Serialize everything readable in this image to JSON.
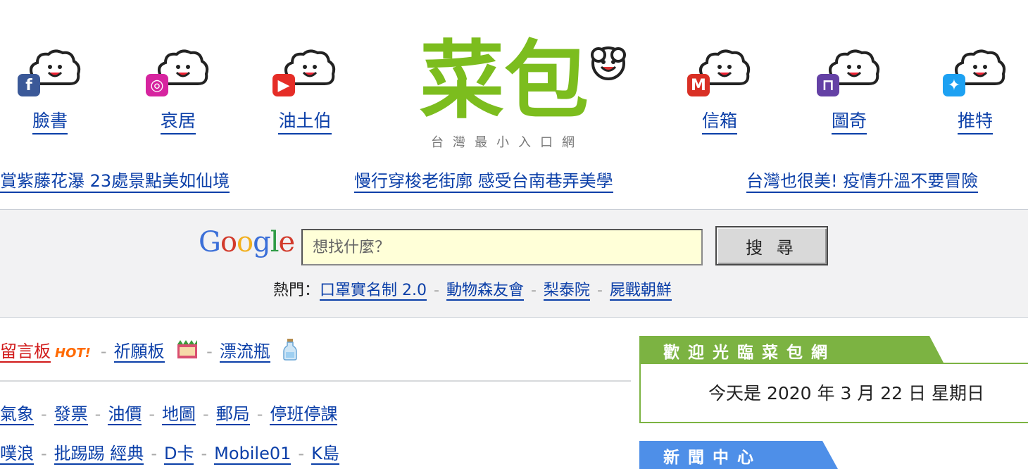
{
  "sites": [
    {
      "label": "臉書",
      "icon": "facebook-icon",
      "color": "#3b5998",
      "badge": "f"
    },
    {
      "label": "哀居",
      "icon": "instagram-icon",
      "color": "#d6249f",
      "badge": "◎"
    },
    {
      "label": "油土伯",
      "icon": "youtube-icon",
      "color": "#e52d27",
      "badge": "▶"
    },
    {
      "label": "信箱",
      "icon": "gmail-icon",
      "color": "#d93025",
      "badge": "M"
    },
    {
      "label": "圖奇",
      "icon": "twitch-icon",
      "color": "#6441a5",
      "badge": "⊓"
    },
    {
      "label": "推特",
      "icon": "twitter-icon",
      "color": "#1da1f2",
      "badge": "✦"
    }
  ],
  "logo": {
    "text": "菜包",
    "tagline": "台灣最小入口網",
    "color": "#7cbd1e"
  },
  "headlines": [
    "賞紫藤花瀑 23處景點美如仙境",
    "慢行穿梭老街廓 感受台南巷弄美學",
    "台灣也很美! 疫情升溫不要冒險"
  ],
  "search": {
    "brand": "Google",
    "placeholder": "想找什麼？",
    "button": "搜 尋",
    "hot_label": "熱門：",
    "hot_items": [
      "口罩實名制 2.0",
      "動物森友會",
      "梨泰院",
      "屍戰朝鮮"
    ]
  },
  "boards": {
    "message_board": "留言板",
    "hot_badge": "HOT!",
    "wish_board": "祈願板",
    "bottle": "漂流瓶"
  },
  "links_row1": [
    "氣象",
    "發票",
    "油價",
    "地圖",
    "郵局",
    "停班停課"
  ],
  "links_row2": [
    "噗浪",
    "批踢踢 經典",
    "D卡",
    "Mobile01",
    "K島"
  ],
  "welcome": {
    "title": "歡迎光臨菜包網",
    "date_text": "今天是 2020 年 3 月 22 日 星期日"
  },
  "news": {
    "title": "新聞中心"
  },
  "colors": {
    "link": "#0b3fa8",
    "green_tab": "#7cb342",
    "blue_tab": "#4e8fe8",
    "search_band": "#f2f2f3"
  }
}
